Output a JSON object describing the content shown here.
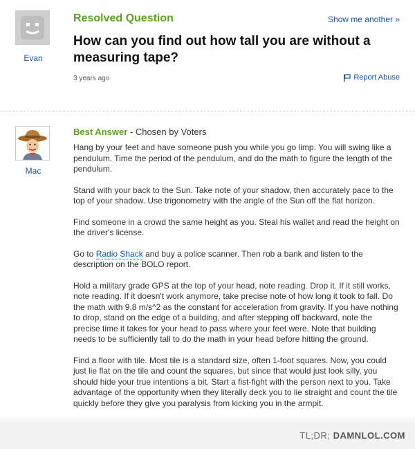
{
  "question": {
    "status_label": "Resolved Question",
    "show_another": "Show me another »",
    "asker": "Evan",
    "title": "How can you find out how tall you are without a measuring tape?",
    "age": "3 years ago",
    "report_abuse": "Report Abuse"
  },
  "answer": {
    "best_answer_label": "Best Answer",
    "chosen_by": " - Chosen by Voters",
    "answerer": "Mac",
    "p1": "Hang by your feet and have someone push you while you go limp. You will swing like a pendulum. Time the period of the pendulum, and do the math to figure the length of the pendulum.",
    "p2": "Stand with your back to the Sun. Take note of your shadow, then accurately pace to the top of your shadow. Use trigonometry with the angle of the Sun off the flat horizon.",
    "p3": "Find someone in a crowd the same height as you. Steal his wallet and read the height on the driver's license.",
    "p4_before": "Go to ",
    "p4_link": "Radio Shack",
    "p4_after": " and buy a police scanner. Then rob a bank and listen to the description on the BOLO report.",
    "p5": "Hold a military grade GPS at the top of your head, note reading. Drop it. If it still works, note reading. If it doesn't work anymore, take precise note of how long it took to fall. Do the math with 9.8 m/s^2 as the constant for acceleration from gravity. If you have nothing to drop, stand on the edge of a building, and after stepping off backward, note the precise time it takes for your head to pass where your feet were. Note that building needs to be sufficiently tall to do the math in your head before hitting the ground.",
    "p6": "Find a floor with tile. Most tile is a standard size, often 1-foot squares. Now, you could just lie flat on the tile and count the squares, but since that would just look silly, you should hide your true intentions a bit. Start a fist-fight with the person next to you. Take advantage of the opportunity when they literally deck you to lie straight and count the tile quickly before they give you paralysis from kicking you in the armpit."
  },
  "footer": {
    "credit_prefix": "TL;DR; ",
    "credit_site": "DAMNLOL.COM"
  },
  "colors": {
    "accent_green": "#5aa51a",
    "link_blue": "#1a57a8"
  }
}
